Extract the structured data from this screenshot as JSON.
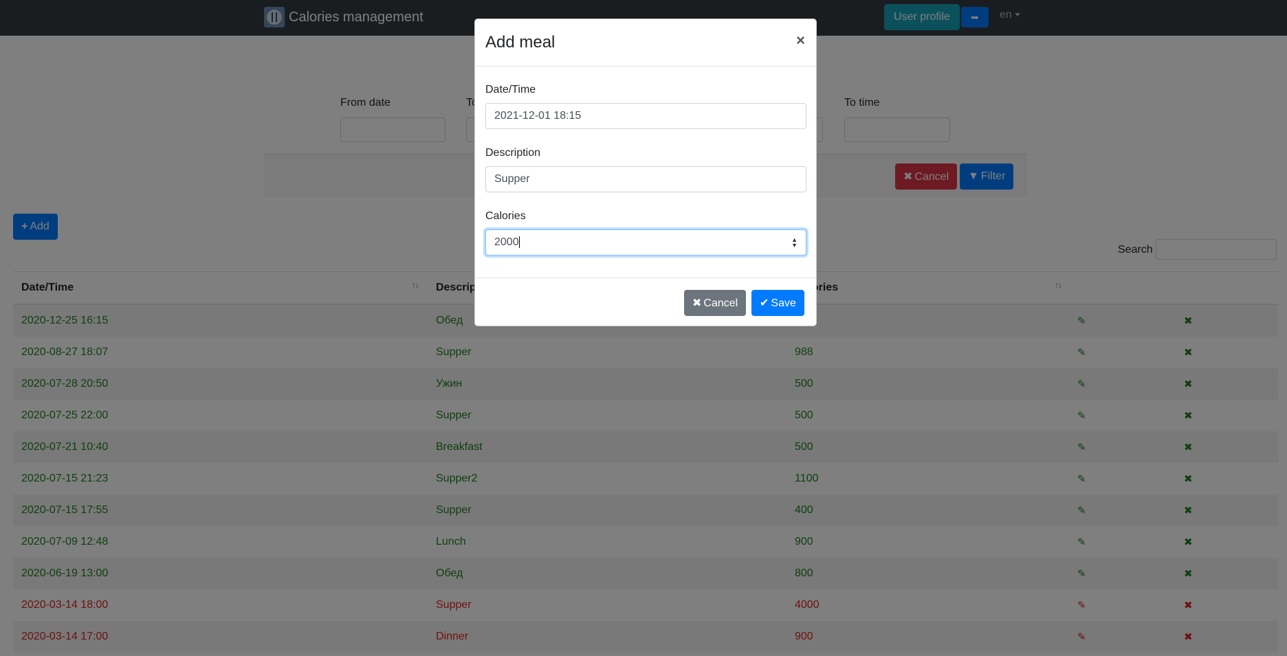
{
  "navbar": {
    "brand": "Calories management",
    "user_profile": "User profile",
    "logout_icon": "sign-out-icon",
    "language": "en"
  },
  "filter": {
    "from_date": "From date",
    "to_date": "To date",
    "to_time": "To time",
    "cancel": "Cancel",
    "filter": "Filter"
  },
  "actions": {
    "add": "Add",
    "search_label": "Search"
  },
  "table": {
    "headers": [
      "Date/Time",
      "Description",
      "Calories"
    ],
    "rows": [
      {
        "datetime": "2020-12-25 16:15",
        "description": "Обед",
        "calories": "",
        "status": "green"
      },
      {
        "datetime": "2020-08-27 18:07",
        "description": "Supper",
        "calories": "988",
        "status": "green"
      },
      {
        "datetime": "2020-07-28 20:50",
        "description": "Ужин",
        "calories": "500",
        "status": "green"
      },
      {
        "datetime": "2020-07-25 22:00",
        "description": "Supper",
        "calories": "500",
        "status": "green"
      },
      {
        "datetime": "2020-07-21 10:40",
        "description": "Breakfast",
        "calories": "500",
        "status": "green"
      },
      {
        "datetime": "2020-07-15 21:23",
        "description": "Supper2",
        "calories": "1100",
        "status": "green"
      },
      {
        "datetime": "2020-07-15 17:55",
        "description": "Supper",
        "calories": "400",
        "status": "green"
      },
      {
        "datetime": "2020-07-09 12:48",
        "description": "Lunch",
        "calories": "900",
        "status": "green"
      },
      {
        "datetime": "2020-06-19 13:00",
        "description": "Обед",
        "calories": "800",
        "status": "green"
      },
      {
        "datetime": "2020-03-14 18:00",
        "description": "Supper",
        "calories": "4000",
        "status": "red"
      },
      {
        "datetime": "2020-03-14 17:00",
        "description": "Dinner",
        "calories": "900",
        "status": "red"
      }
    ]
  },
  "modal": {
    "title": "Add meal",
    "datetime_label": "Date/Time",
    "datetime_value": "2021-12-01 18:15",
    "description_label": "Description",
    "description_value": "Supper",
    "calories_label": "Calories",
    "calories_value": "2000",
    "cancel": "Cancel",
    "save": "Save"
  },
  "colors": {
    "green": "#1e7e1e",
    "red": "#e02020",
    "primary": "#007bff",
    "danger": "#dc3545",
    "info": "#17a2b8"
  }
}
